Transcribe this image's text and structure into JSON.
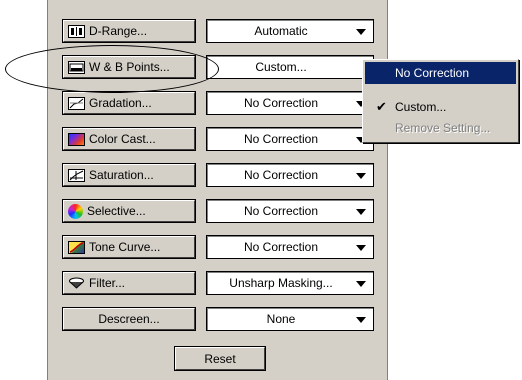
{
  "panel": {
    "rows": [
      {
        "button": "D-Range...",
        "icon": "d-range-icon",
        "value": "Automatic"
      },
      {
        "button": "W & B Points...",
        "icon": "white-black-points-icon",
        "value": "Custom..."
      },
      {
        "button": "Gradation...",
        "icon": "gradation-icon",
        "value": "No Correction"
      },
      {
        "button": "Color Cast...",
        "icon": "color-cast-icon",
        "value": "No Correction"
      },
      {
        "button": "Saturation...",
        "icon": "saturation-icon",
        "value": "No Correction"
      },
      {
        "button": "Selective...",
        "icon": "selective-color-icon",
        "value": "No Correction"
      },
      {
        "button": "Tone Curve...",
        "icon": "tone-curve-icon",
        "value": "No Correction"
      },
      {
        "button": "Filter...",
        "icon": "filter-icon",
        "value": "Unsharp Masking..."
      },
      {
        "button": "Descreen...",
        "icon": "",
        "value": "None"
      }
    ],
    "reset_label": "Reset"
  },
  "dropdown_menu": {
    "items": [
      {
        "label": "No Correction",
        "state": "highlighted"
      },
      {
        "label": "Custom...",
        "state": "checked"
      },
      {
        "label": "Remove Setting...",
        "state": "disabled"
      }
    ]
  },
  "colors": {
    "panel_bg": "#d4d0c8",
    "highlight": "#0a246a",
    "disabled_text": "#808080"
  }
}
